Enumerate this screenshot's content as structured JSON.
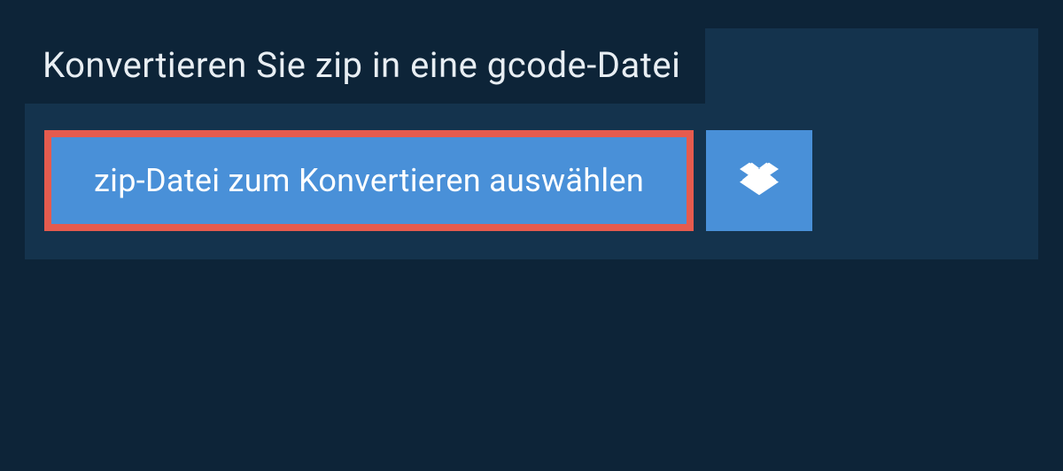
{
  "header": {
    "title": "Konvertieren Sie zip in eine gcode-Datei"
  },
  "buttons": {
    "select_file_label": "zip-Datei zum Konvertieren auswählen",
    "dropbox_icon": "dropbox-icon"
  }
}
